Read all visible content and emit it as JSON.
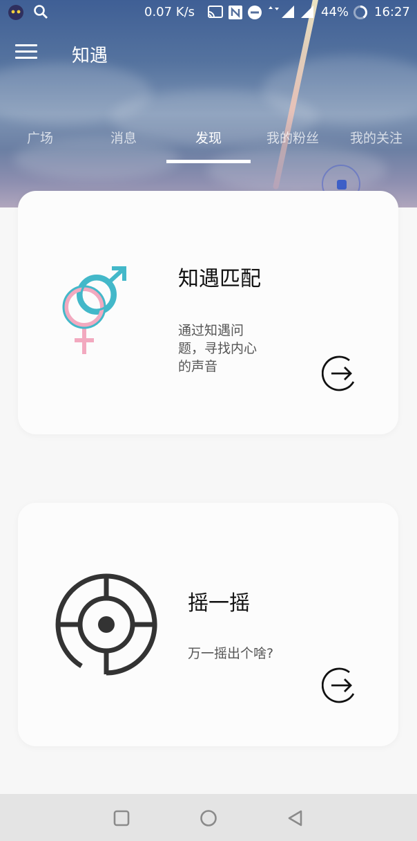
{
  "status_bar": {
    "net_speed": "0.07 K/s",
    "battery": "44%",
    "time": "16:27",
    "icons": [
      "app-cat-icon",
      "search-icon",
      "cast-icon",
      "nfc-icon",
      "dnd-icon",
      "data-arrows-icon",
      "signal-icon",
      "battery-icon"
    ]
  },
  "app_bar": {
    "title": "知遇",
    "menu_icon": "hamburger-menu-icon"
  },
  "tabs": [
    {
      "label": "广场"
    },
    {
      "label": "消息"
    },
    {
      "label": "发现",
      "active": true
    },
    {
      "label": "我的粉丝"
    },
    {
      "label": "我的关注"
    }
  ],
  "cards": [
    {
      "title": "知遇匹配",
      "desc": [
        "通过知遇问",
        "题，寻找内心",
        "的声音"
      ],
      "icon": "gender-symbols-icon",
      "action_icon": "arrow-right-circle-icon"
    },
    {
      "title": "摇一摇",
      "desc": [
        "万一摇出个啥?"
      ],
      "icon": "target-icon",
      "action_icon": "arrow-right-circle-icon"
    }
  ],
  "nav_bar": {
    "icons": [
      "recents-square-icon",
      "home-circle-icon",
      "back-triangle-icon"
    ]
  },
  "colors": {
    "accent": "#3d5fc7",
    "pink": "#f2a9bf",
    "teal": "#43b8c9",
    "dark_icon": "#333333"
  }
}
